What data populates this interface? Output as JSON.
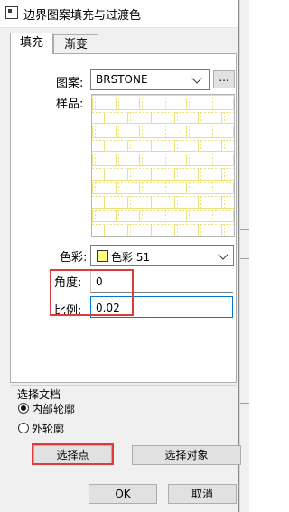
{
  "window": {
    "title": "边界图案填充与过渡色"
  },
  "tabs": [
    {
      "label": "填充",
      "active": true
    },
    {
      "label": "渐变",
      "active": false
    }
  ],
  "fill": {
    "pattern_label": "图案:",
    "pattern_value": "BRSTONE",
    "browse_label": "...",
    "sample_label": "样品:",
    "color_label": "色彩:",
    "color_value": "色彩 51",
    "color_swatch": "#ffff80",
    "angle_label": "角度:",
    "angle_value": "0",
    "scale_label": "比例:",
    "scale_value": "0.02"
  },
  "select_doc": {
    "group_label": "选择文档",
    "options": [
      {
        "label": "内部轮廓",
        "selected": true
      },
      {
        "label": "外轮廓",
        "selected": false
      }
    ],
    "pick_points_label": "选择点",
    "select_objects_label": "选择对象"
  },
  "footer": {
    "ok_label": "OK",
    "cancel_label": "取消"
  },
  "colors": {
    "highlight": "#e03a3a",
    "pattern_line": "#ece07a",
    "focus": "#0078d7"
  }
}
